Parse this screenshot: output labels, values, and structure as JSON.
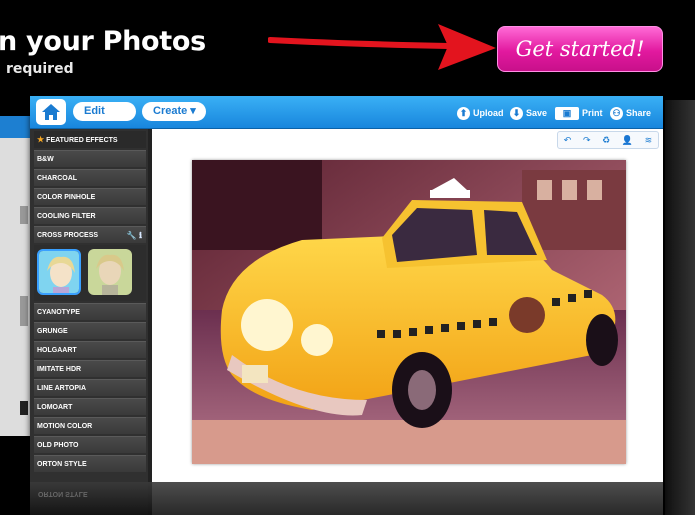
{
  "hero": {
    "title": "n your Photos",
    "subtitle": "required",
    "cta_label": "Get started!"
  },
  "toolbar": {
    "edit_label": "Edit",
    "create_label": "Create ▾",
    "upload_label": "Upload",
    "save_label": "Save",
    "print_label": "Print",
    "share_label": "Share"
  },
  "sidebar": {
    "featured_label": "FEATURED EFFECTS",
    "items_top": [
      "B&W",
      "CHARCOAL",
      "COLOR PINHOLE",
      "COOLING FILTER"
    ],
    "cross_process_label": "CROSS PROCESS",
    "cross_process_tools": "🔧 ℹ",
    "items_bottom": [
      "CYANOTYPE",
      "GRUNGE",
      "HOLGAART",
      "IMITATE HDR",
      "LINE ARTOPIA",
      "LOMOART",
      "MOTION COLOR",
      "OLD PHOTO",
      "ORTON STYLE"
    ],
    "reflection_text": "ORTON STYLE"
  },
  "canvas_tools": [
    "↶",
    "↷",
    "♻",
    "👤",
    "≋"
  ],
  "photo": {
    "subject": "yellow taxi cab"
  },
  "colors": {
    "accent": "#1886dd",
    "cta": "#e2199f",
    "sidebar": "#303030"
  }
}
